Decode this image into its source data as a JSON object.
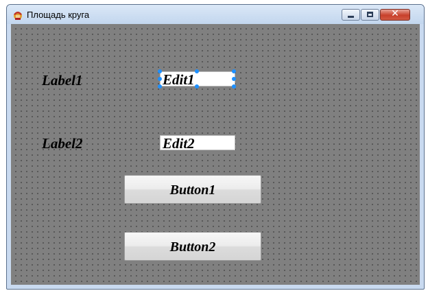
{
  "window": {
    "title": "Площадь круга",
    "controls": {
      "minimize": "minimize",
      "maximize": "maximize",
      "close": "✕"
    }
  },
  "form": {
    "label1": "Label1",
    "label2": "Label2",
    "edit1": "Edit1",
    "edit2": "Edit2",
    "button1": "Button1",
    "button2": "Button2"
  },
  "colors": {
    "form_background": "#808080",
    "selection_handle": "#1e90ff"
  }
}
